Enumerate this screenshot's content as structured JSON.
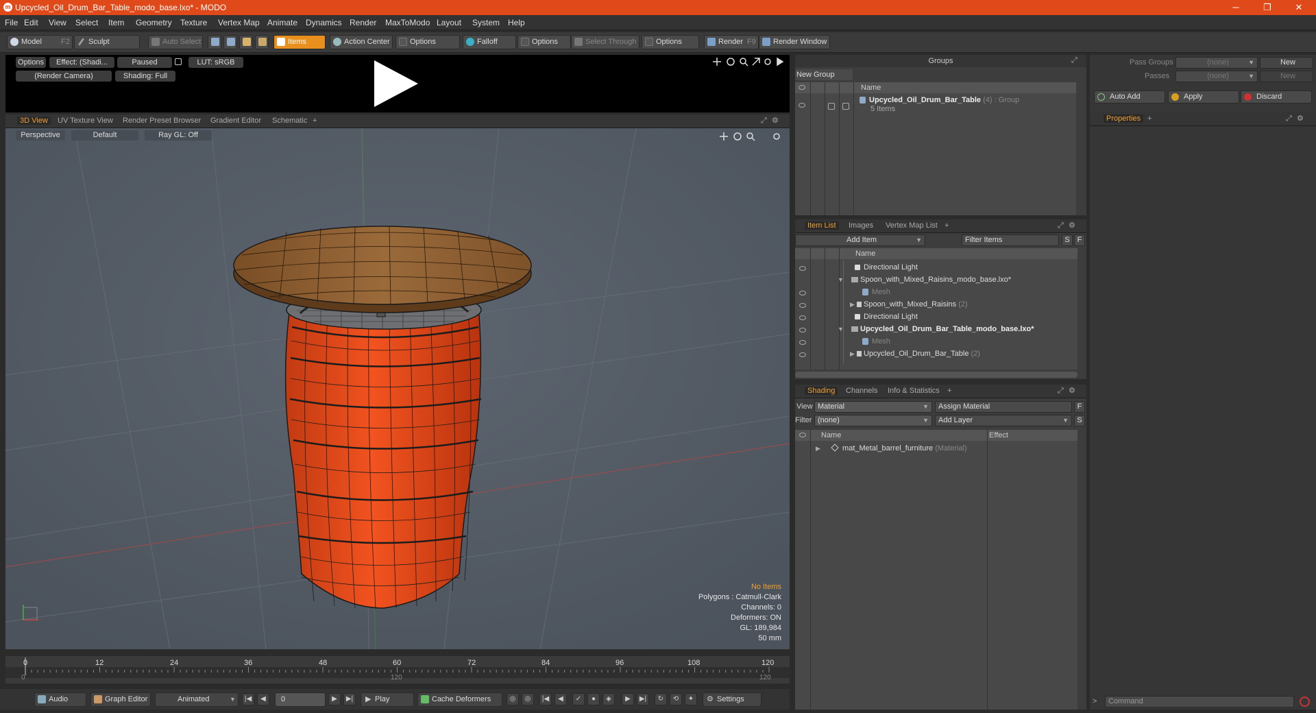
{
  "window": {
    "title": "Upcycled_Oil_Drum_Bar_Table_modo_base.lxo* - MODO",
    "minimize": "─",
    "restore": "❐",
    "close": "✕"
  },
  "menu": [
    "File",
    "Edit",
    "View",
    "Select",
    "Item",
    "Geometry",
    "Texture",
    "Vertex Map",
    "Animate",
    "Dynamics",
    "Render",
    "MaxToModo",
    "Layout",
    "System",
    "Help"
  ],
  "toolbar": {
    "model": "Model",
    "model_key": "F2",
    "sculpt": "Sculpt",
    "auto_select": "Auto Select",
    "items": "Items",
    "action_center": "Action Center",
    "options1": "Options",
    "falloff": "Falloff",
    "options2": "Options",
    "select_through": "Select Through",
    "options3": "Options",
    "render": "Render",
    "render_key": "F9",
    "render_window": "Render Window"
  },
  "render_preview": {
    "options": "Options",
    "effect": "Effect: (Shadi...",
    "paused": "Paused",
    "lut": "LUT: sRGB",
    "camera": "(Render Camera)",
    "shading": "Shading: Full"
  },
  "viewport_tabs": [
    "3D View",
    "UV Texture View",
    "Render Preset Browser",
    "Gradient Editor",
    "Schematic",
    "+"
  ],
  "viewport": {
    "perspective": "Perspective",
    "default": "Default",
    "raygl": "Ray GL: Off",
    "stats": {
      "items": "No Items",
      "polygons": "Polygons : Catmull-Clark",
      "channels": "Channels: 0",
      "deformers": "Deformers: ON",
      "gl": "GL: 189,984",
      "focal": "50 mm"
    }
  },
  "timeline": {
    "ticks": [
      "0",
      "12",
      "24",
      "36",
      "48",
      "60",
      "72",
      "84",
      "96",
      "108",
      "120"
    ],
    "sub_start": "0",
    "sub_mid": "120",
    "sub_end": "120"
  },
  "bottombar": {
    "audio": "Audio",
    "graph_editor": "Graph Editor",
    "animated": "Animated",
    "frame": "0",
    "play": "Play",
    "cache_deformers": "Cache Deformers",
    "settings": "Settings"
  },
  "groups": {
    "title": "Groups",
    "new_group": "New Group",
    "col_name": "Name",
    "row_name": "Upcycled_Oil_Drum_Bar_Table",
    "row_count": "(4)",
    "row_type": ": Group",
    "row_items": "5 Items"
  },
  "passgroups": {
    "pass_groups": "Pass Groups",
    "pass_value": "(none)",
    "new1": "New",
    "passes": "Passes",
    "passes_value": "(none)",
    "new2": "New",
    "auto_add": "Auto Add",
    "apply": "Apply",
    "discard": "Discard",
    "properties": "Properties",
    "plus": "+"
  },
  "itemlist": {
    "tabs": [
      "Item List",
      "Images",
      "Vertex Map List",
      "+"
    ],
    "add_item": "Add Item",
    "filter": "Filter Items",
    "s": "S",
    "f": "F",
    "col_name": "Name",
    "rows": [
      {
        "label": "Directional Light",
        "extra": ""
      },
      {
        "label": "Spoon_with_Mixed_Raisins_modo_base.lxo*",
        "extra": ""
      },
      {
        "label": "Mesh",
        "extra": ""
      },
      {
        "label": "Spoon_with_Mixed_Raisins",
        "extra": "(2)"
      },
      {
        "label": "Directional Light",
        "extra": ""
      },
      {
        "label": "Upcycled_Oil_Drum_Bar_Table_modo_base.lxo*",
        "extra": ""
      },
      {
        "label": "Mesh",
        "extra": ""
      },
      {
        "label": "Upcycled_Oil_Drum_Bar_Table",
        "extra": "(2)"
      }
    ]
  },
  "shading": {
    "tabs": [
      "Shading",
      "Channels",
      "Info & Statistics",
      "+"
    ],
    "view_label": "View",
    "view_value": "Material",
    "assign": "Assign Material",
    "f": "F",
    "filter_label": "Filter",
    "filter_value": "(none)",
    "add_layer": "Add Layer",
    "s": "S",
    "col_name": "Name",
    "col_effect": "Effect",
    "row_name": "mat_Metal_barrel_furniture",
    "row_type": "(Material)"
  },
  "command": {
    "placeholder": "Command",
    "prompt": ">"
  },
  "colors": {
    "accent": "#e98f1d",
    "titlebar": "#e04a1b",
    "barrel": "#e8471c",
    "wood": "#8a5a2e"
  }
}
